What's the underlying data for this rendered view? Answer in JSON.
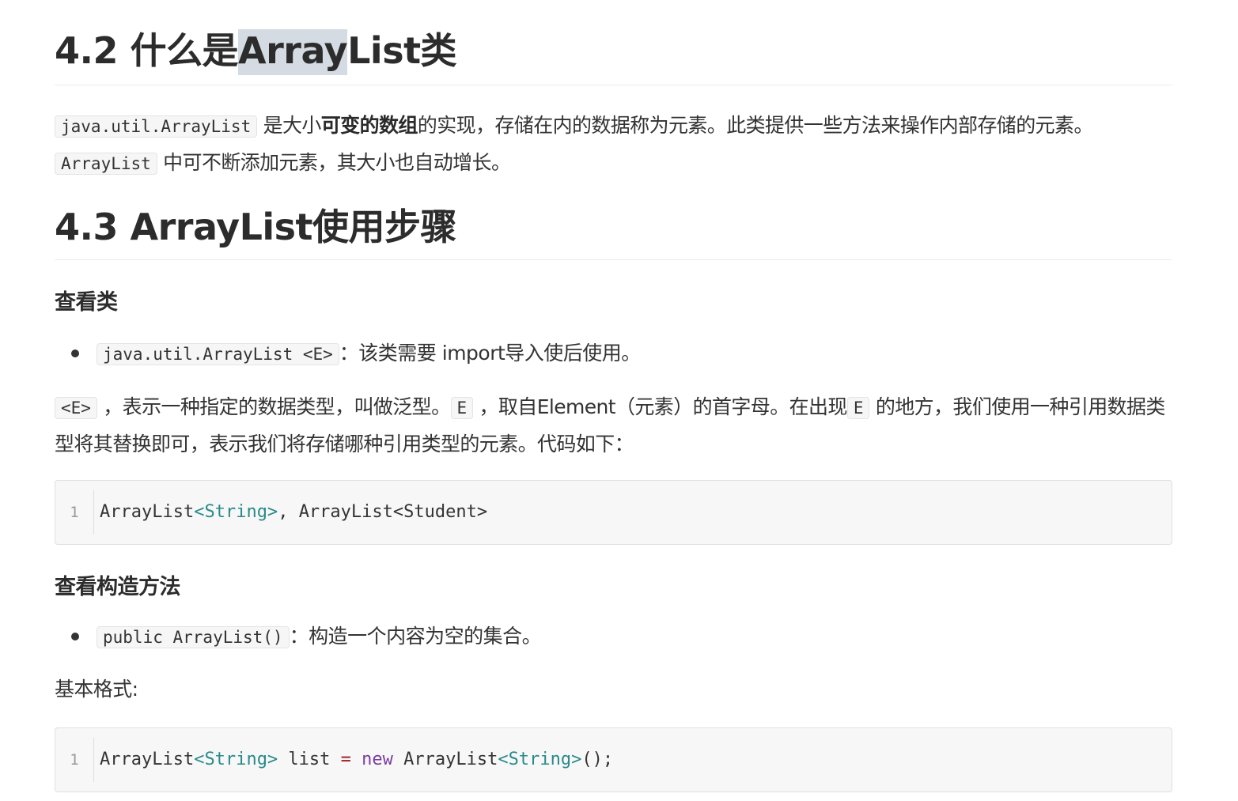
{
  "section_42": {
    "title_prefix": "4.2 什么是",
    "title_selected": "Array",
    "title_suffix": "List类",
    "para": {
      "code1": "java.util.ArrayList",
      "t1": " 是大小",
      "bold": "可变的数组",
      "t2": "的实现，存储在内的数据称为元素。此类提供一些方法来操作内部存储的元素。",
      "code2": "ArrayList",
      "t3": " 中可不断添加元素，其大小也自动增长。"
    }
  },
  "section_43": {
    "title": "4.3 ArrayList使用步骤",
    "view_class": {
      "heading": "查看类",
      "bullet_code": "java.util.ArrayList <E>",
      "bullet_text": "：该类需要 import导入使后使用。",
      "desc": {
        "code1": "<E>",
        "t1": " ，表示一种指定的数据类型，叫做泛型。",
        "code2": "E",
        "t2": " ，取自Element（元素）的首字母。在出现",
        "code3": "E",
        "t3": " 的地方，我们使用一种引用数据类型将其替换即可，表示我们将存储哪种引用类型的元素。代码如下："
      },
      "code_block": {
        "line_no": "1",
        "tokens": [
          "ArrayList",
          "<String>",
          ", ",
          "ArrayList",
          "<Student>"
        ]
      }
    },
    "view_ctor": {
      "heading": "查看构造方法",
      "bullet_code": "public ArrayList()",
      "bullet_text": "：构造一个内容为空的集合。",
      "format_label": "基本格式:",
      "code_block": {
        "line_no": "1",
        "tokens": [
          "ArrayList",
          "<String>",
          " list ",
          "=",
          " ",
          "new",
          " ArrayList",
          "<String>",
          "();"
        ]
      }
    }
  }
}
